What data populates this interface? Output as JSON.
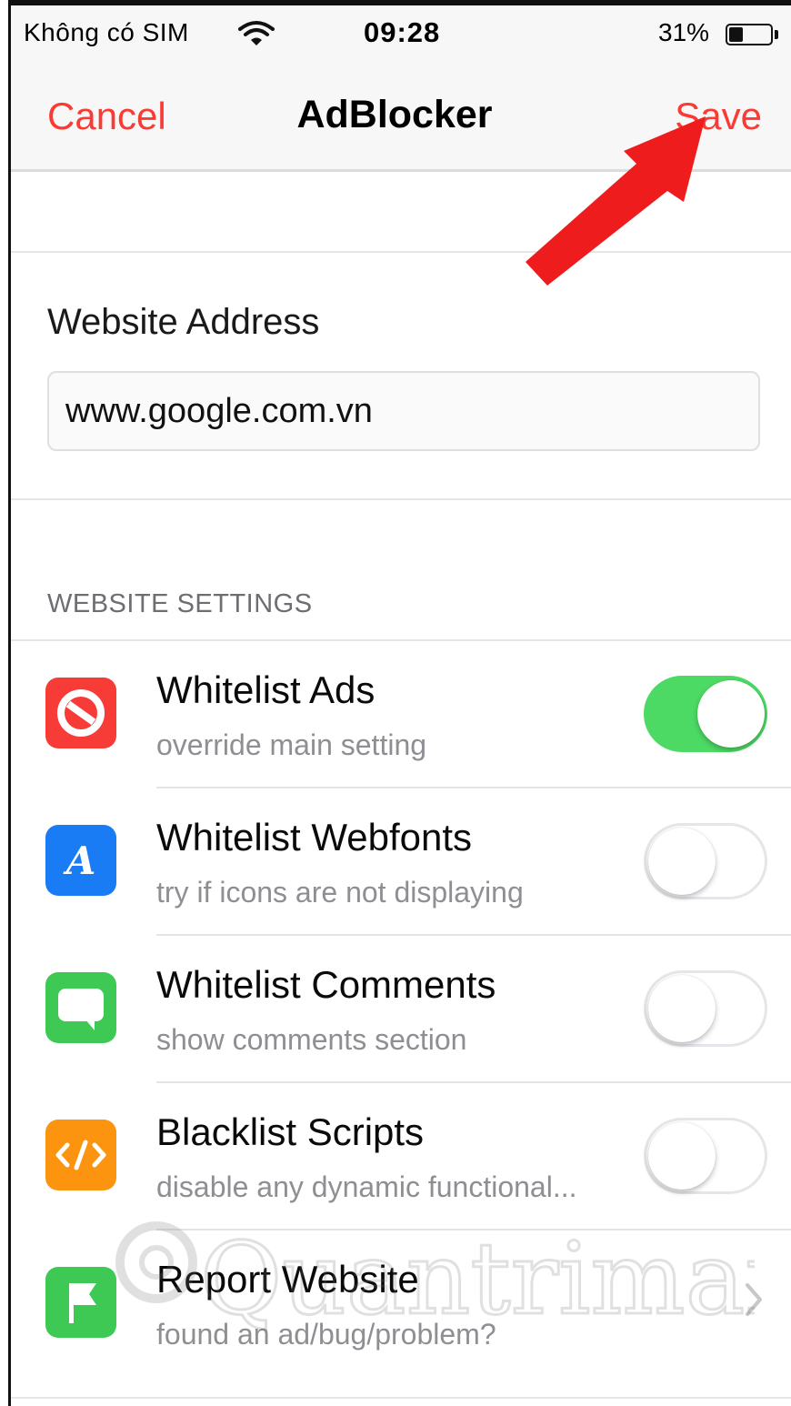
{
  "status_bar": {
    "carrier": "Không có SIM",
    "time": "09:28",
    "battery_percent_label": "31%",
    "battery_level": 0.31
  },
  "nav": {
    "cancel": "Cancel",
    "title": "AdBlocker",
    "save": "Save"
  },
  "website": {
    "label": "Website Address",
    "value": "www.google.com.vn"
  },
  "settings": {
    "header": "WEBSITE SETTINGS",
    "items": [
      {
        "title": "Whitelist Ads",
        "subtitle": "override main setting",
        "icon": "block-icon",
        "color": "#f73b36",
        "control": "toggle",
        "on": true
      },
      {
        "title": "Whitelist Webfonts",
        "subtitle": "try if icons are not displaying",
        "icon": "font-icon",
        "color": "#1a7cf5",
        "control": "toggle",
        "on": false
      },
      {
        "title": "Whitelist Comments",
        "subtitle": "show comments section",
        "icon": "speech-bubble-icon",
        "color": "#3ec954",
        "control": "toggle",
        "on": false
      },
      {
        "title": "Blacklist Scripts",
        "subtitle": "disable any dynamic functional...",
        "icon": "code-icon",
        "color": "#fc9410",
        "control": "toggle",
        "on": false
      },
      {
        "title": "Report Website",
        "subtitle": "found an ad/bug/problem?",
        "icon": "flag-icon",
        "color": "#3ec954",
        "control": "chevron"
      }
    ]
  },
  "colors": {
    "accent": "#fb3a33",
    "toggle_on": "#4cd964",
    "annotation_arrow": "#ee1c1c"
  },
  "watermark_text": "Quantrimang"
}
